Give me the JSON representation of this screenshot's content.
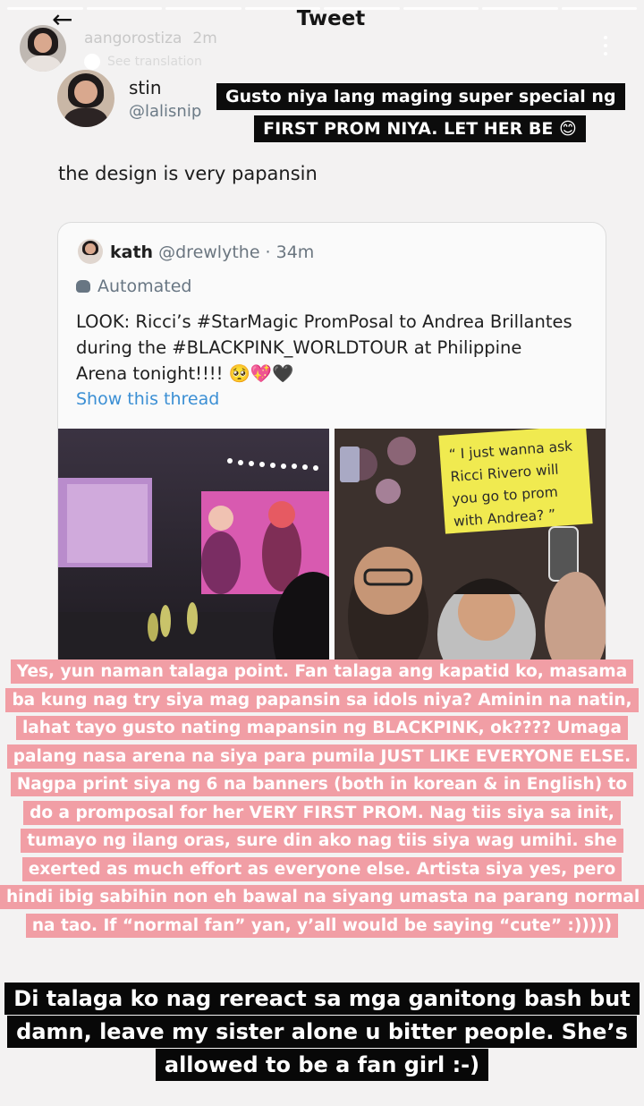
{
  "story": {
    "username": "aangorostiza",
    "time": "2m",
    "see_translation": "See translation"
  },
  "tweet_header": {
    "back_icon": "arrow-left-icon",
    "title": "Tweet"
  },
  "tweet": {
    "author_name": "stin",
    "author_handle": "@lalisnip",
    "text": "the design is very papansin"
  },
  "quoted_tweet": {
    "author_name": "kath",
    "author_meta": "@drewlythe · 34m",
    "automated_label": "Automated",
    "body": "LOOK: Ricci’s #StarMagic PromPosal to Andrea Brillantes during the #BLACKPINK_WORLDTOUR at Philippine Arena tonight!!!! 🥺💖🖤",
    "show_thread": "Show this thread",
    "sign_text": "“ I just wanna ask Ricci Rivero will you go to prom with Andrea? ”"
  },
  "overlays": {
    "top_caption": "Gusto niya lang maging super special ng FIRST PROM NIYA. LET HER BE 😊",
    "pink_caption": "Yes, yun naman talaga point. Fan talaga ang kapatid ko, masama ba kung nag try siya mag papansin sa idols niya? Aminin na natin, lahat tayo gusto nating mapansin ng BLACKPINK, ok???? Umaga palang nasa arena na siya para pumila JUST LIKE EVERYONE ELSE. Nagpa print siya ng 6 na banners (both in korean & in English) to do a promposal for her VERY FIRST PROM. Nag tiis siya sa init, tumayo ng ilang oras, sure din ako nag tiis siya wag umihi. she exerted as much effort as everyone else. Artista siya yes, pero hindi ibig sabihin non eh bawal na siyang umasta na parang normal na tao. If “normal fan” yan, y’all would be saying “cute” :)))))",
    "bottom_caption": "Di talaga ko nag rereact sa mga ganitong bash but damn, leave my sister alone u bitter people. She’s allowed to be a fan girl :-)"
  },
  "colors": {
    "pink_box": "#f19ea5",
    "dark_box": "#0c0c0c",
    "link_blue": "#3b8fd4",
    "sign_yellow": "#f0ea50"
  }
}
